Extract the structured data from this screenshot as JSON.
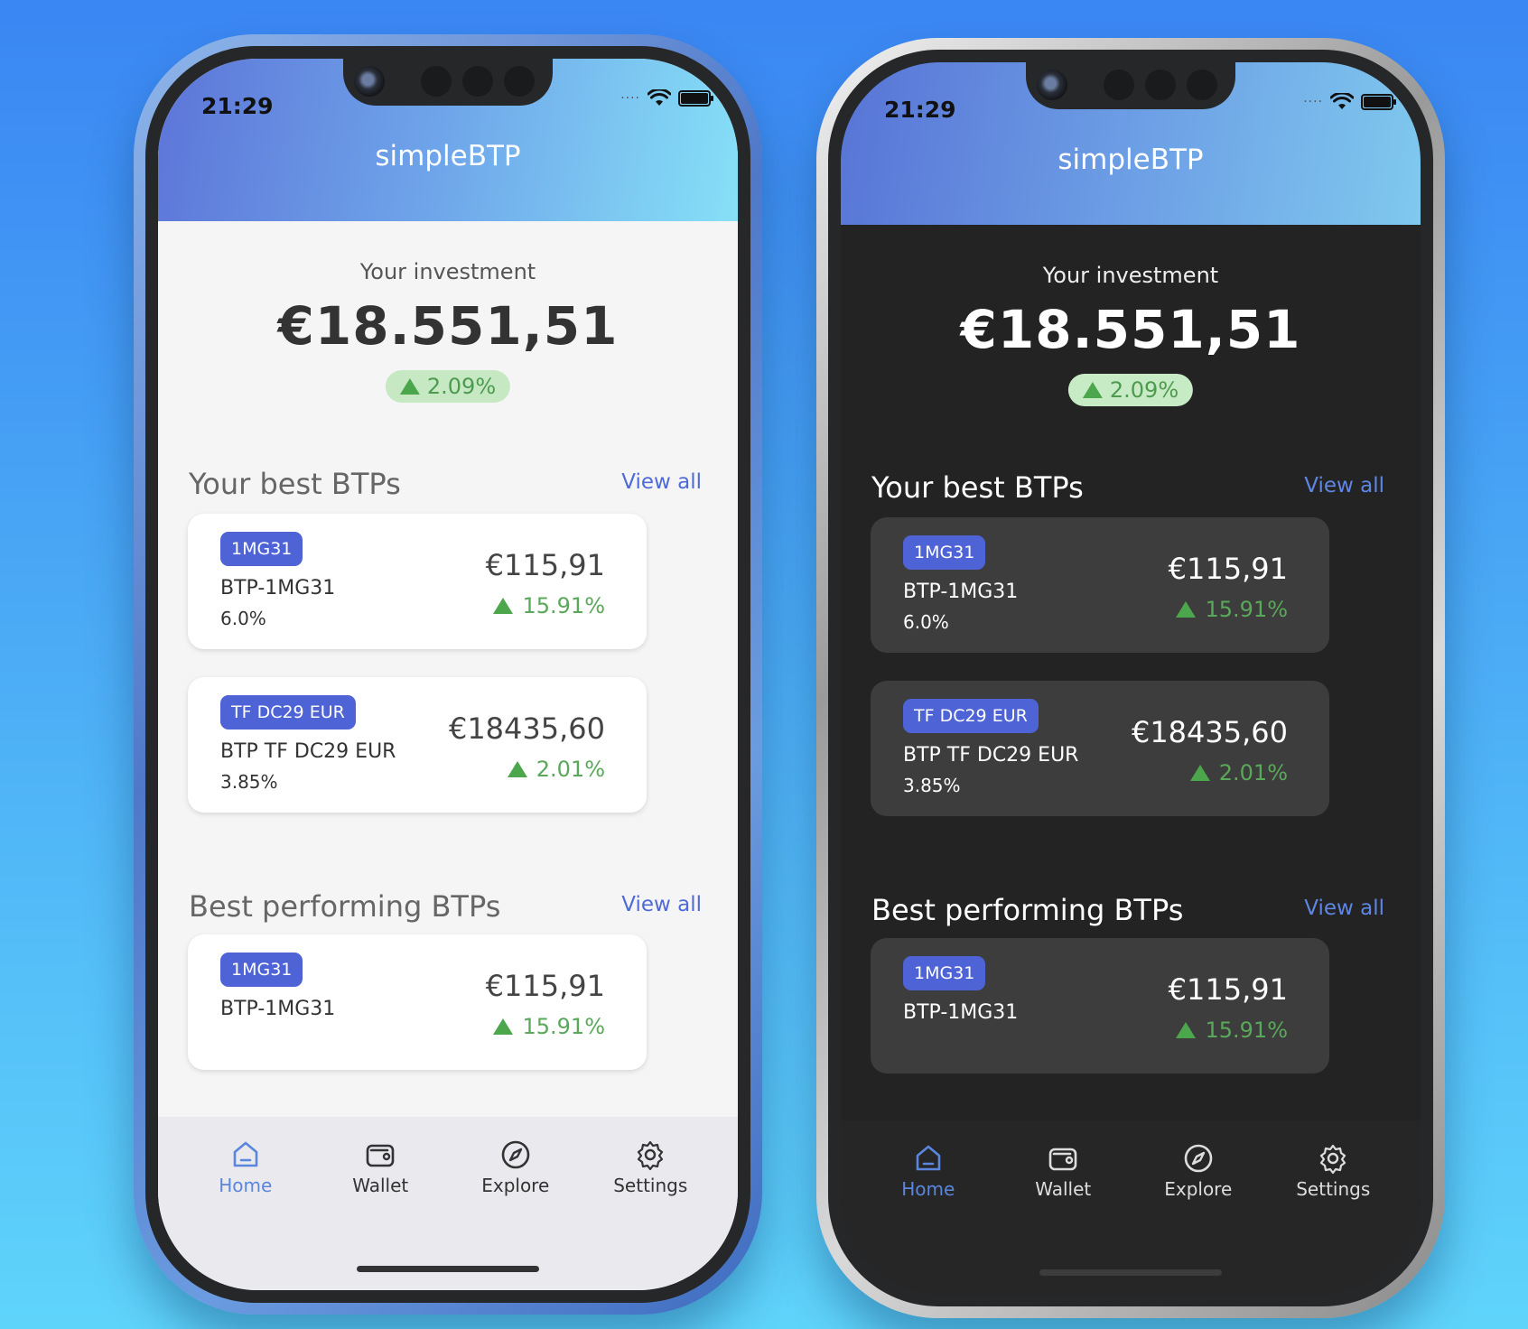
{
  "phones": {
    "light": {
      "status": {
        "time": "21:29"
      },
      "header": {
        "title": "simpleBTP"
      },
      "investment": {
        "label": "Your investment",
        "amount": "€18.551,51",
        "change": "2.09%"
      },
      "best": {
        "title": "Your best BTPs",
        "view_all": "View all",
        "cards": [
          {
            "tag": "1MG31",
            "name": "BTP-1MG31",
            "rate": "6.0%",
            "price": "€115,91",
            "change": "15.91%"
          },
          {
            "tag": "TF DC29 EUR",
            "name": "BTP TF DC29 EUR",
            "rate": "3.85%",
            "price": "€18435,60",
            "change": "2.01%"
          }
        ]
      },
      "performing": {
        "title": "Best performing BTPs",
        "view_all": "View all",
        "cards": [
          {
            "tag": "1MG31",
            "name": "BTP-1MG31",
            "price": "€115,91",
            "change": "15.91%"
          }
        ]
      },
      "tabbar": {
        "home": "Home",
        "wallet": "Wallet",
        "explore": "Explore",
        "settings": "Settings"
      }
    },
    "dark": {
      "status": {
        "time": "21:29"
      },
      "header": {
        "title": "simpleBTP"
      },
      "investment": {
        "label": "Your investment",
        "amount": "€18.551,51",
        "change": "2.09%"
      },
      "best": {
        "title": "Your best BTPs",
        "view_all": "View all",
        "cards": [
          {
            "tag": "1MG31",
            "name": "BTP-1MG31",
            "rate": "6.0%",
            "price": "€115,91",
            "change": "15.91%"
          },
          {
            "tag": "TF DC29 EUR",
            "name": "BTP TF DC29 EUR",
            "rate": "3.85%",
            "price": "€18435,60",
            "change": "2.01%"
          }
        ]
      },
      "performing": {
        "title": "Best performing BTPs",
        "view_all": "View all",
        "cards": [
          {
            "tag": "1MG31",
            "name": "BTP-1MG31",
            "price": "€115,91",
            "change": "15.91%"
          }
        ]
      },
      "tabbar": {
        "home": "Home",
        "wallet": "Wallet",
        "explore": "Explore",
        "settings": "Settings"
      }
    }
  },
  "status_icons": [
    "wifi-icon",
    "battery-icon"
  ],
  "colors": {
    "accent": "#4e63d6",
    "positive": "#4ca64c",
    "header_start": "#5d75d8",
    "header_end": "#86e0f7"
  }
}
